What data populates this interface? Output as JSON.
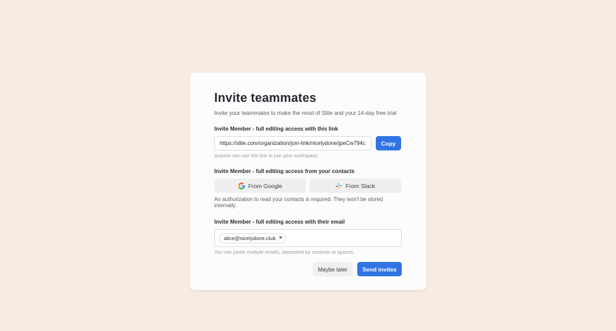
{
  "modal": {
    "title": "Invite teammates",
    "subtitle": "Invite your teammates to make the most of Slite and your 14-day free trial",
    "link_section": {
      "label": "Invite Member - full editing access with this link",
      "link_value": "https://slite.com/organization/join-link/nicelydone/jpeCw794c",
      "copy_label": "Copy",
      "helper": "Anyone can use this link to join your workspace."
    },
    "contacts_section": {
      "label": "Invite Member - full editing access from your contacts",
      "google_label": "From Google",
      "google_icon": "google-icon",
      "slack_label": "From Slack",
      "slack_icon": "slack-icon",
      "note": "An authorization to read your contacts is required. They won't be stored internally."
    },
    "email_section": {
      "label": "Invite Member - full editing access with their email",
      "chips": [
        "alice@nicelydone.club"
      ],
      "remove_icon": "close-icon",
      "helper": "You can paste multiple emails, separated by commas or spaces."
    },
    "footer": {
      "maybe_later_label": "Maybe later",
      "send_label": "Send invites"
    }
  },
  "colors": {
    "page_background": "#f8ece2",
    "modal_background": "#fcfcfc",
    "primary": "#2f74e2",
    "secondary_button": "#efefef"
  }
}
